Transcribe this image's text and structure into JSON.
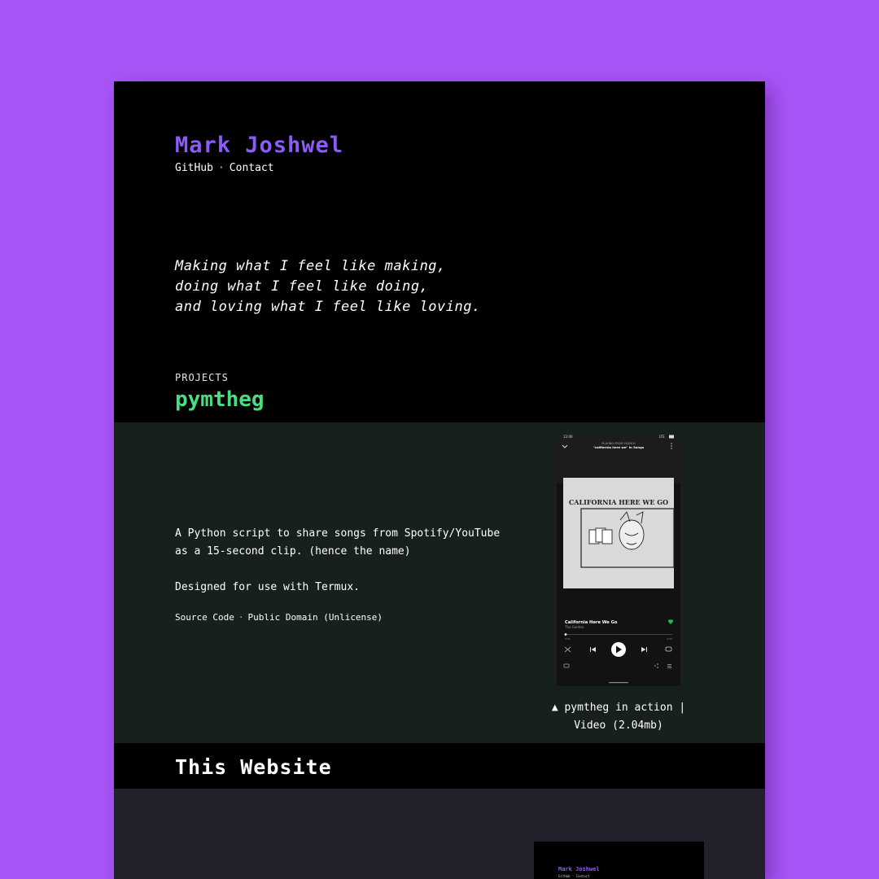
{
  "header": {
    "name": "Mark Joshwel",
    "nav": [
      "GitHub",
      "Contact"
    ],
    "separator": "·"
  },
  "tagline": [
    "Making what I feel like making,",
    "doing what I feel like doing,",
    "and loving what I feel like loving."
  ],
  "projects": {
    "label": "PROJECTS",
    "pymtheg": {
      "title": "pymtheg",
      "description_1": "A Python script to share songs from Spotify/YouTube as a 15-second clip. (hence the name)",
      "description_2": "Designed for use with Termux.",
      "source_link": "Source Code",
      "license_link": "Public Domain (Unlicense)",
      "caption_line_1": "▲ pymtheg in action |",
      "caption_line_2": "Video (2.04mb)",
      "phone": {
        "status_time": "12:00",
        "status_right": "LTE",
        "playing_from": "PLAYING FROM SEARCH",
        "playlist": "\"california here we\" in Songs",
        "album_art_text": "CALIFORNIA HERE WE GO",
        "song": "California Here We Go",
        "artist": "The Garden",
        "time_elapsed": "0:00",
        "time_total": "2:05",
        "accent": "#1db954"
      }
    }
  },
  "this_website": {
    "title": "This Website",
    "thumb_name": "Mark Joshwel",
    "thumb_nav": "GitHub · Contact"
  },
  "colors": {
    "background": "#a855f7",
    "name": "#8b5cf6",
    "project_title": "#4ade80",
    "project_bg": "#18201c",
    "bottom_bg": "#22212b"
  }
}
